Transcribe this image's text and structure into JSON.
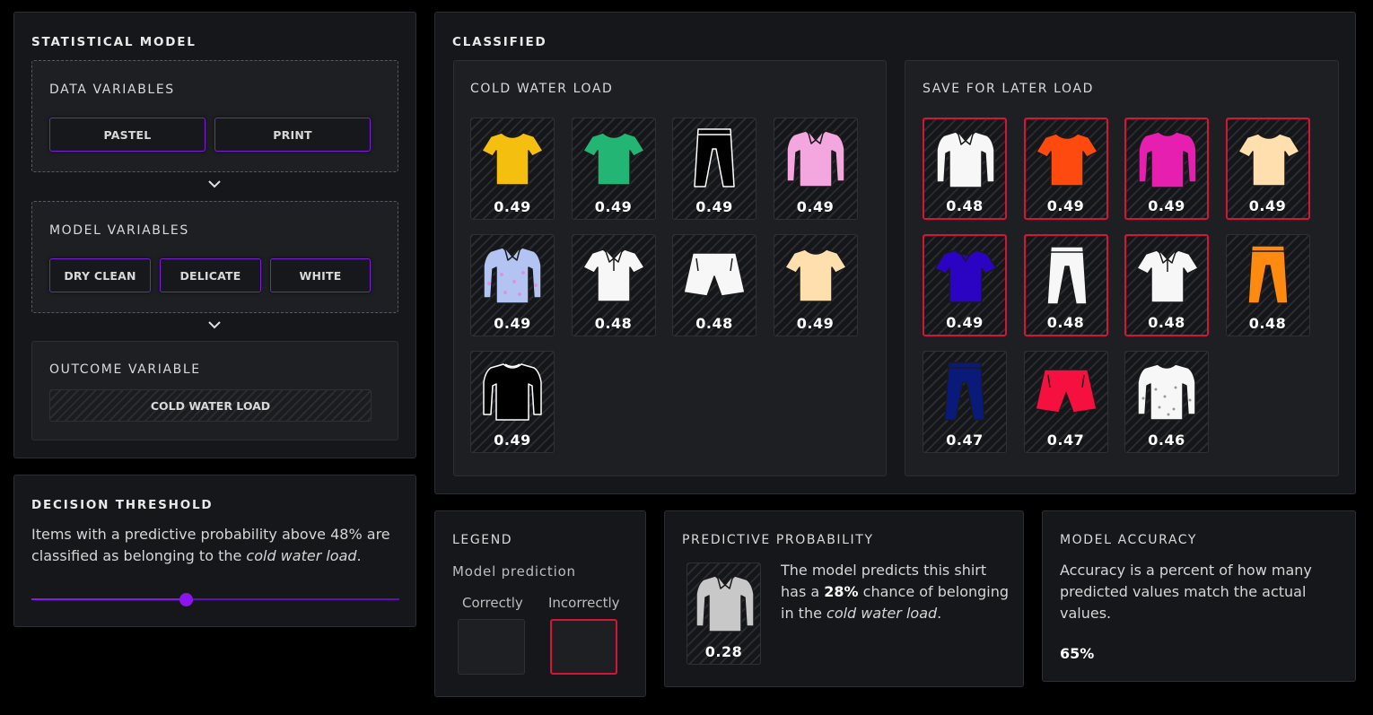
{
  "statistical_model": {
    "title": "STATISTICAL MODEL",
    "data_variables": {
      "title": "DATA VARIABLES",
      "buttons": [
        "PASTEL",
        "PRINT"
      ]
    },
    "model_variables": {
      "title": "MODEL VARIABLES",
      "buttons": [
        "DRY CLEAN",
        "DELICATE",
        "WHITE"
      ]
    },
    "outcome_variable": {
      "title": "OUTCOME VARIABLE",
      "value": "COLD WATER LOAD"
    }
  },
  "decision_threshold": {
    "title": "DECISION THRESHOLD",
    "text_before": "Items with a predictive probability above 48% are classified as belonging to the ",
    "text_em": "cold water load",
    "text_after": ".",
    "slider_value": 0.42
  },
  "classified": {
    "title": "CLASSIFIED",
    "groups": [
      {
        "title": "COLD WATER LOAD",
        "items": [
          {
            "type": "tshirt",
            "color": "#f5bf0f",
            "prob": "0.49",
            "correct": true
          },
          {
            "type": "tshirt",
            "color": "#22b573",
            "prob": "0.49",
            "correct": true
          },
          {
            "type": "pants",
            "color": "#000000",
            "prob": "0.49",
            "correct": true
          },
          {
            "type": "longsleeve",
            "color": "#f4a6df",
            "prob": "0.49",
            "correct": true
          },
          {
            "type": "longsleeve-print",
            "color": "#b3c4f2",
            "prob": "0.49",
            "correct": true
          },
          {
            "type": "polo",
            "color": "#f7f7f7",
            "prob": "0.48",
            "correct": true
          },
          {
            "type": "shorts",
            "color": "#f7f7f7",
            "prob": "0.48",
            "correct": true
          },
          {
            "type": "tshirt",
            "color": "#ffdfae",
            "prob": "0.49",
            "correct": true
          },
          {
            "type": "sweater",
            "color": "#000000",
            "prob": "0.49",
            "correct": true
          }
        ]
      },
      {
        "title": "SAVE FOR LATER LOAD",
        "items": [
          {
            "type": "longsleeve",
            "color": "#f7f7f7",
            "prob": "0.48",
            "correct": false
          },
          {
            "type": "tshirt",
            "color": "#ff4a0f",
            "prob": "0.49",
            "correct": false
          },
          {
            "type": "sweater",
            "color": "#e61fb1",
            "prob": "0.49",
            "correct": false
          },
          {
            "type": "tshirt",
            "color": "#ffdfae",
            "prob": "0.49",
            "correct": false
          },
          {
            "type": "vneck",
            "color": "#2a04c2",
            "prob": "0.49",
            "correct": false
          },
          {
            "type": "pants",
            "color": "#f7f7f7",
            "prob": "0.48",
            "correct": false
          },
          {
            "type": "polo",
            "color": "#f7f7f7",
            "prob": "0.48",
            "correct": false
          },
          {
            "type": "pants",
            "color": "#ff8a10",
            "prob": "0.48",
            "correct": true
          },
          {
            "type": "pants",
            "color": "#0a1a7a",
            "prob": "0.47",
            "correct": true
          },
          {
            "type": "shorts",
            "color": "#f5103f",
            "prob": "0.47",
            "correct": true
          },
          {
            "type": "sweater-print",
            "color": "#f7f7f7",
            "prob": "0.46",
            "correct": true
          }
        ]
      }
    ]
  },
  "legend": {
    "title": "LEGEND",
    "subtitle": "Model prediction",
    "correct_label": "Correctly",
    "incorrect_label": "Incorrectly"
  },
  "predictive_probability": {
    "title": "PREDICTIVE PROBABILITY",
    "example": {
      "type": "longsleeve",
      "color": "#c8c8c8",
      "prob": "0.28"
    },
    "text_1": "The model predicts this shirt has a ",
    "text_bold": "28%",
    "text_2": " chance of belonging in the ",
    "text_em": "cold water load",
    "text_3": "."
  },
  "model_accuracy": {
    "title": "MODEL ACCURACY",
    "description": "Accuracy is a percent of how many predicted values match the actual values.",
    "value": "65%"
  },
  "colors": {
    "accent": "#8c14f0",
    "incorrect": "#d41538",
    "panel": "#16171a"
  }
}
